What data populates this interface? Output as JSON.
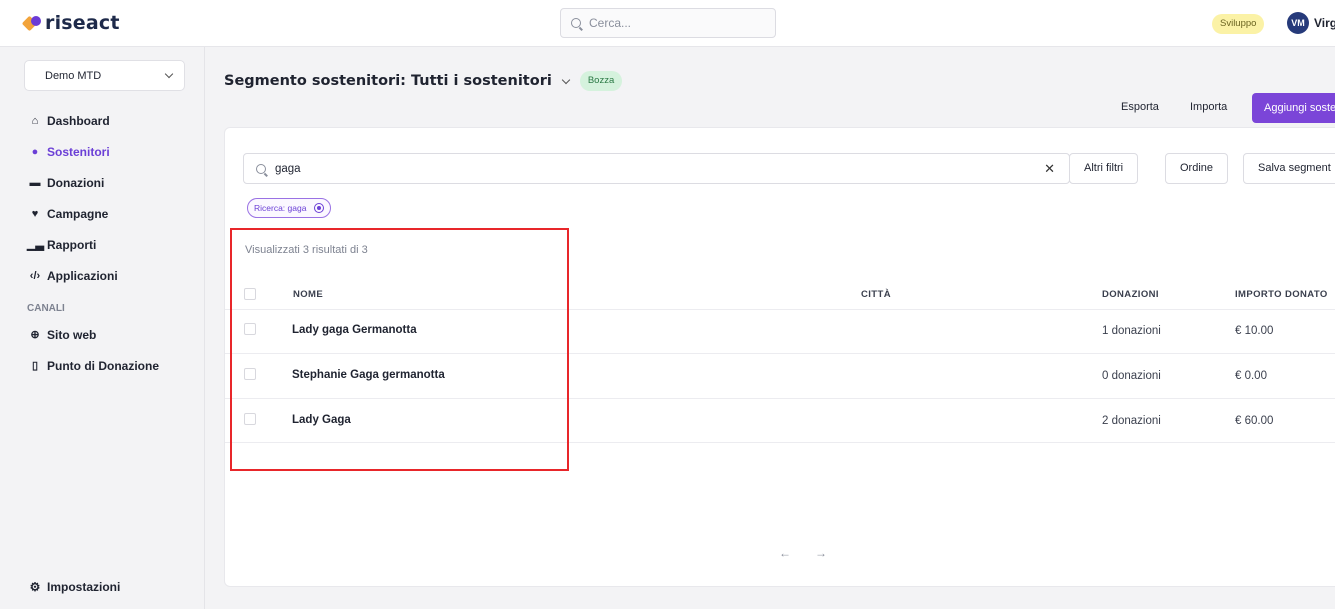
{
  "topbar": {
    "logo_text": "riseact",
    "search_placeholder": "Cerca...",
    "env_badge": "Sviluppo",
    "user_initials": "VM",
    "user_name": "Virg"
  },
  "sidebar": {
    "org_selector": "Demo MTD",
    "nav": [
      {
        "label": "Dashboard",
        "icon": "home-icon"
      },
      {
        "label": "Sostenitori",
        "icon": "user-icon",
        "active": true
      },
      {
        "label": "Donazioni",
        "icon": "credit-card-icon"
      },
      {
        "label": "Campagne",
        "icon": "heart-icon"
      },
      {
        "label": "Rapporti",
        "icon": "chart-icon"
      },
      {
        "label": "Applicazioni",
        "icon": "code-icon"
      }
    ],
    "section_label": "CANALI",
    "channels": [
      {
        "label": "Sito web",
        "icon": "globe-icon"
      },
      {
        "label": "Punto di Donazione",
        "icon": "tablet-icon"
      }
    ],
    "settings_label": "Impostazioni"
  },
  "header": {
    "title": "Segmento sostenitori: Tutti i sostenitori",
    "status_badge": "Bozza",
    "export_label": "Esporta",
    "import_label": "Importa",
    "add_label": "Aggiungi soste"
  },
  "filters": {
    "search_value": "gaga",
    "more_filters_label": "Altri filtri",
    "sort_label": "Ordine",
    "save_segment_label": "Salva segment",
    "active_chip": "Ricerca: gaga"
  },
  "results": {
    "summary": "Visualizzati 3 risultati di 3",
    "columns": {
      "name": "NOME",
      "city": "CITTÀ",
      "donations": "DONAZIONI",
      "amount": "IMPORTO DONATO"
    },
    "rows": [
      {
        "name": "Lady gaga Germanotta",
        "city": "",
        "donations": "1 donazioni",
        "amount": "€ 10.00"
      },
      {
        "name": "Stephanie Gaga germanotta",
        "city": "",
        "donations": "0 donazioni",
        "amount": "€ 0.00"
      },
      {
        "name": "Lady Gaga",
        "city": "",
        "donations": "2 donazioni",
        "amount": "€ 60.00"
      }
    ]
  },
  "pagination": {
    "prev": "←",
    "next": "→"
  },
  "colors": {
    "accent": "#7b45d8",
    "highlight": "#e8262a",
    "draft_badge_bg": "#d5f2dd",
    "env_badge_bg": "#fbf2a6"
  }
}
